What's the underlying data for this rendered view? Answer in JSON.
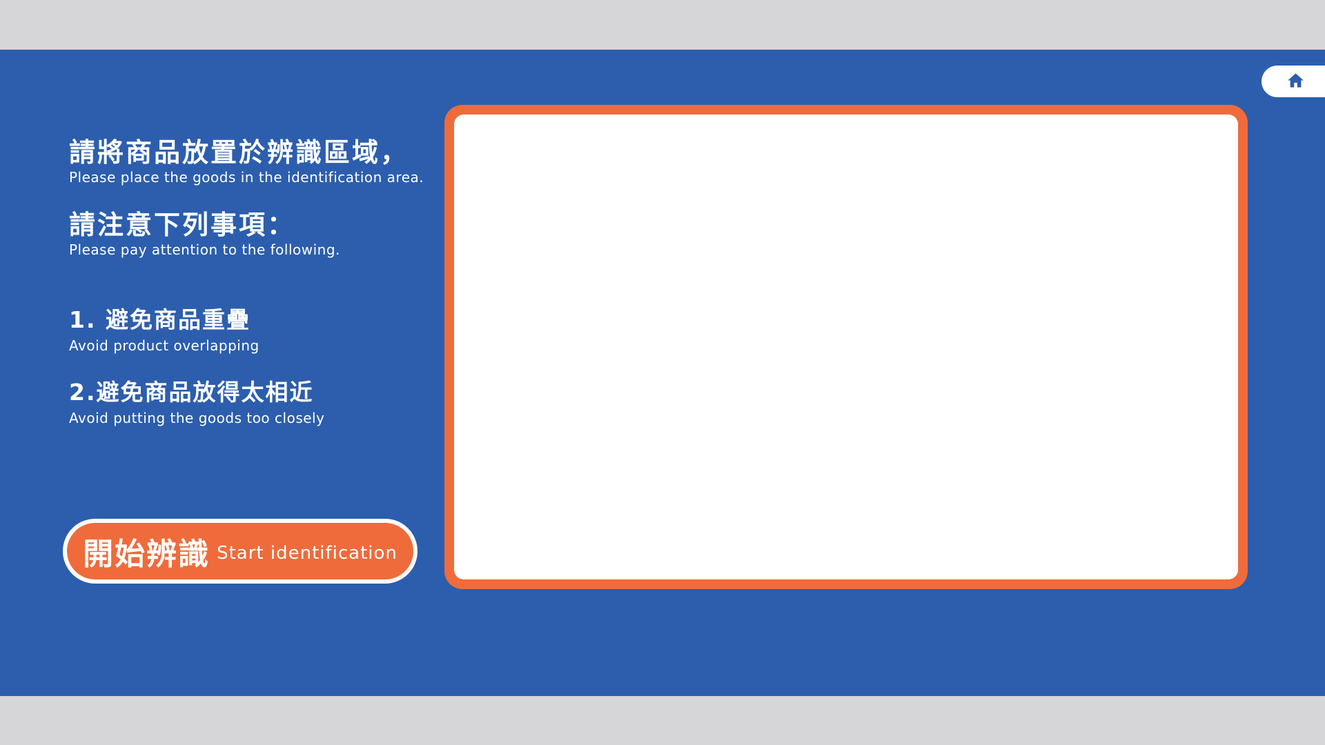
{
  "instructions": {
    "place_zh": "請將商品放置於辨識區域，",
    "place_en": "Please place the goods in the identification area.",
    "attention_zh": "請注意下列事項：",
    "attention_en": "Please pay attention to the following.",
    "items": [
      {
        "zh": "1. 避免商品重疊",
        "en": "Avoid product overlapping"
      },
      {
        "zh": "2.避免商品放得太相近",
        "en": "Avoid putting the goods too closely"
      }
    ]
  },
  "start_button": {
    "label_zh": "開始辨識",
    "label_en": "Start identification"
  },
  "home_button": {
    "icon": "home-icon"
  },
  "colors": {
    "background": "#2c5ead",
    "accent": "#ef6b3b",
    "outer": "#d6d6d8",
    "panel": "#ffffff"
  }
}
